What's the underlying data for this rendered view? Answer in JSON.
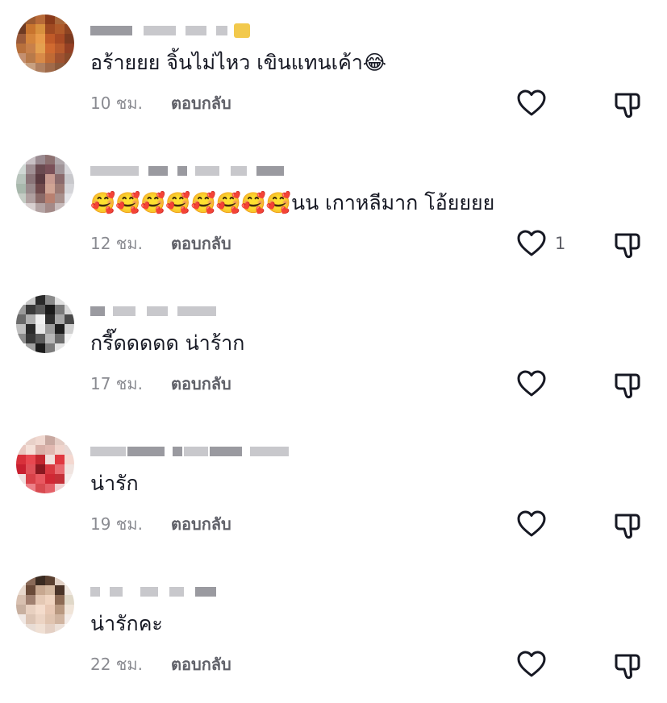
{
  "comments": [
    {
      "text": "อร้ายยย จิ้นไม่ไหว เขินแทนเค้า😂",
      "time": "10 ชม.",
      "reply_label": "ตอบกลับ",
      "like_count": "",
      "avatar_colors": [
        "#7a4a2a",
        "#9c5a30",
        "#b86a38",
        "#8a3a1a",
        "#a8663a",
        "#c47a44",
        "#6e3a22",
        "#c8742e",
        "#d8903e",
        "#a04a22",
        "#b05a2a",
        "#8e4422",
        "#9a5a3a",
        "#d4843c",
        "#e89a4a",
        "#c05a28",
        "#a84a24",
        "#7c3a20",
        "#b8703c",
        "#c8804a",
        "#e4a050",
        "#d06a30",
        "#b85a2c",
        "#944024",
        "#c49070",
        "#b87a4a",
        "#d88a48",
        "#c06a34",
        "#a05230",
        "#8a4a2a",
        "#e0c0a8",
        "#c8a080",
        "#b08060",
        "#a06a4a",
        "#8c5a3c",
        "#7a4a30"
      ]
    },
    {
      "text": "🥰🥰🥰🥰🥰🥰🥰🥰นน เกาหลีมาก โอ้ยยยย",
      "time": "12 ชม.",
      "reply_label": "ตอบกลับ",
      "like_count": "1",
      "avatar_colors": [
        "#e8e8ec",
        "#c8c0c4",
        "#9a8a90",
        "#8c7070",
        "#b0a8ac",
        "#e0e0e4",
        "#d0d8d4",
        "#a09094",
        "#6a4a50",
        "#7a5058",
        "#a09498",
        "#d8d8dc",
        "#b8c4bc",
        "#8a7478",
        "#5a3a40",
        "#c89a90",
        "#8a6a6c",
        "#c8c8cc",
        "#a8b8ac",
        "#9a8a8c",
        "#704a4c",
        "#d0a494",
        "#9c7a74",
        "#d4d4d8",
        "#c4ccc4",
        "#b0a0a0",
        "#8a6a68",
        "#b88070",
        "#a8908c",
        "#e4e4e8",
        "#ececf0",
        "#d8d0d0",
        "#b4a4a4",
        "#a48a88",
        "#c8bcbc",
        "#f0f0f2"
      ]
    },
    {
      "text": "กรี๊ดดดดด น่าร้าก",
      "time": "17 ชม.",
      "reply_label": "ตอบกลับ",
      "like_count": "",
      "avatar_colors": [
        "#f4f4f4",
        "#c8c8c8",
        "#2a2a2a",
        "#8a8a8a",
        "#e0e0e0",
        "#f8f8f8",
        "#9a9a9a",
        "#3a3a3a",
        "#5a5a5a",
        "#1a1a1a",
        "#7a7a7a",
        "#d8d8d8",
        "#6a6a6a",
        "#b0b0b0",
        "#f0f0f0",
        "#2e2e2e",
        "#a8a8a8",
        "#4a4a4a",
        "#c0c0c0",
        "#2a2a2a",
        "#e8e8e8",
        "#9c9c9c",
        "#1e1e1e",
        "#d0d0d0",
        "#8c8c8c",
        "#383838",
        "#5c5c5c",
        "#b8b8b8",
        "#6c6c6c",
        "#f2f2f2",
        "#f6f6f6",
        "#a0a0a0",
        "#1c1c1c",
        "#7c7c7c",
        "#e4e4e4",
        "#fafafa"
      ]
    },
    {
      "text": "น่ารัก",
      "time": "19 ชม.",
      "reply_label": "ตอบกลับ",
      "like_count": "",
      "avatar_colors": [
        "#f4ece8",
        "#e8d0c8",
        "#f0d8d0",
        "#c8a8a0",
        "#e4ccc4",
        "#f8f0ec",
        "#e8c8c0",
        "#f4e0d8",
        "#d8b0a8",
        "#e0b8b0",
        "#f0d4cc",
        "#e8d8d4",
        "#d8303a",
        "#e84850",
        "#c42830",
        "#f0e0dc",
        "#e03840",
        "#f4d8d0",
        "#c82030",
        "#e05058",
        "#8a1820",
        "#d83840",
        "#e86a70",
        "#f0e4e0",
        "#f0e0e0",
        "#d84048",
        "#e85860",
        "#d02834",
        "#c43038",
        "#f4ecea",
        "#f8f4f2",
        "#ec8088",
        "#d84a50",
        "#e46068",
        "#f0d0d0",
        "#faf6f4"
      ]
    },
    {
      "text": "น่ารักคะ",
      "time": "22 ชม.",
      "reply_label": "ตอบกลับ",
      "like_count": "",
      "avatar_colors": [
        "#f4f0ec",
        "#8a6a58",
        "#3a2a20",
        "#5a4030",
        "#e0d0c4",
        "#f8f4f0",
        "#e8d8cc",
        "#6a4a38",
        "#c8a890",
        "#d4b8a0",
        "#4a3428",
        "#f0e8e0",
        "#d8c0b0",
        "#a08070",
        "#e4c8b4",
        "#f0d4c0",
        "#8c6a54",
        "#e0d8c8",
        "#c8b0a0",
        "#e8d0c0",
        "#f4dccc",
        "#e8c8b4",
        "#b89880",
        "#f0e4d8",
        "#f0e8e4",
        "#dcc4b4",
        "#ecd4c4",
        "#e0c4b0",
        "#d0b4a0",
        "#f4ece8",
        "#faf8f6",
        "#e8dcd4",
        "#f0e0d4",
        "#e4d0c4",
        "#ece0d8",
        "#fcfaf8"
      ]
    }
  ]
}
